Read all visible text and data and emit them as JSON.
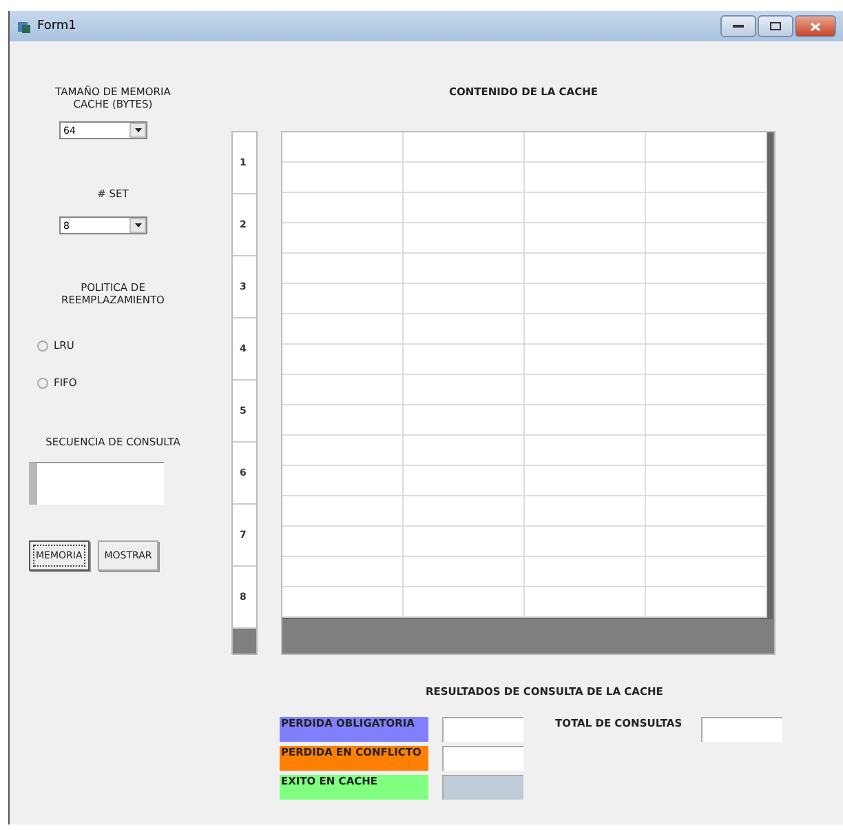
{
  "window": {
    "title": "Form1"
  },
  "cache_size": {
    "label": "TAMAÑO DE MEMORIA CACHE (BYTES)",
    "value": "64"
  },
  "sets": {
    "label": "# SET",
    "value": "8"
  },
  "policy": {
    "label": "POLITICA DE REEMPLAZAMIENTO",
    "options": [
      {
        "label": "LRU",
        "selected": false
      },
      {
        "label": "FIFO",
        "selected": false
      }
    ]
  },
  "sequence": {
    "label": "SECUENCIA DE CONSULTA"
  },
  "buttons": [
    {
      "label": "MEMORIA",
      "focused": true
    },
    {
      "label": "MOSTRAR",
      "focused": false
    }
  ],
  "contents": {
    "title": "CONTENIDO DE LA CACHE",
    "set_labels": [
      "1",
      "2",
      "3",
      "4",
      "5",
      "6",
      "7",
      "8"
    ]
  },
  "results": {
    "title": "RESULTADOS DE CONSULTA DE LA CACHE",
    "items": [
      {
        "label": "PERDIDA OBLIGATORIA",
        "color": "#8080ff",
        "disabled": false
      },
      {
        "label": "PERDIDA EN CONFLICTO",
        "color": "#ff8000",
        "disabled": false
      },
      {
        "label": "EXITO EN CACHE",
        "color": "#80ff80",
        "disabled": true
      }
    ],
    "total_label": "TOTAL DE CONSULTAS"
  }
}
